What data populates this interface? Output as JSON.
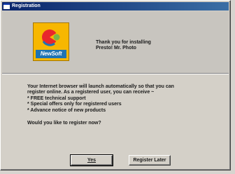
{
  "window": {
    "title": "Registration"
  },
  "header": {
    "logo_text": "NewSoft",
    "thanks_line1": "Thank you for installing",
    "thanks_line2": "Presto! Mr. Photo"
  },
  "message": {
    "intro_line1": "Your Internet browser will launch automatically so that you can",
    "intro_line2": "register online. As a registered user, you can receive ~",
    "benefits": [
      "* FREE technical support",
      "* Special offers only for registered users",
      "* Advance notice of new products"
    ],
    "question": "Would you like to register now?"
  },
  "buttons": {
    "yes": "Yes",
    "later": "Register Later"
  },
  "colors": {
    "titlebar_start": "#0a246a",
    "titlebar_end": "#3a6ea5",
    "logo_bg": "#f7b700",
    "logo_band": "#1f74b3"
  }
}
